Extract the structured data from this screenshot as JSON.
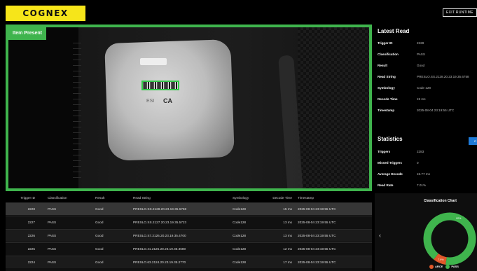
{
  "header": {
    "logo": "COGNEX",
    "exit_label": "EXIT RUNTIME"
  },
  "image": {
    "status_label": "Item Present",
    "package_text": "CA",
    "package_sub": "ESI"
  },
  "latest_read": {
    "title": "Latest Read",
    "fields": [
      {
        "label": "Trigger ID",
        "value": "2228"
      },
      {
        "label": "Classification",
        "value": "PASS"
      },
      {
        "label": "Result",
        "value": "Good"
      },
      {
        "label": "Read String",
        "value": "PRESLO.SS.2128.20.23.19.35.6758"
      },
      {
        "label": "Symbology",
        "value": "Code 128"
      },
      {
        "label": "Decode Time",
        "value": "19 ms"
      },
      {
        "label": "Timestamp",
        "value": "2025-08-04 23:19:55 UTC"
      }
    ]
  },
  "statistics": {
    "title": "Statistics",
    "button_label": "R",
    "fields": [
      {
        "label": "Triggers",
        "value": "2283"
      },
      {
        "label": "Missed Triggers",
        "value": "0"
      },
      {
        "label": "Average Decode",
        "value": "15.77 ms"
      },
      {
        "label": "Read Rate",
        "value": "7.01%"
      }
    ]
  },
  "table": {
    "columns": [
      "Trigger ID",
      "Classification",
      "Result",
      "Read String",
      "Symbology",
      "Decode Time",
      "Timestamp"
    ],
    "rows": [
      [
        "2228",
        "PASS",
        "Good",
        "PRESLO.SS.2128.20.23.19.35.6758",
        "Code128",
        "15 ms",
        "2025-08-04 23:19:55 UTC"
      ],
      [
        "2227",
        "PASS",
        "Good",
        "PRESLO.SS.2127.20.23.19.35.5723",
        "Code128",
        "13 ms",
        "2025-08-04 23:19:55 UTC"
      ],
      [
        "2226",
        "PASS",
        "Good",
        "PRESLO.S7.2126.20.23.19.35.4700",
        "Code128",
        "13 ms",
        "2025-08-04 23:19:55 UTC"
      ],
      [
        "2225",
        "PASS",
        "Good",
        "PRESLO.41.2125.20.23.19.35.3680",
        "Code128",
        "12 ms",
        "2025-08-04 23:19:55 UTC"
      ],
      [
        "2224",
        "PASS",
        "Good",
        "PRESLO.63.2124.20.23.19.35.2770",
        "Code128",
        "17 ms",
        "2025-08-04 23:19:55 UTC"
      ]
    ]
  },
  "chart_data": {
    "type": "pie",
    "title": "Classification Chart",
    "categories": [
      "PASS",
      "ARCE"
    ],
    "values": [
      92.03,
      7.97
    ],
    "labels": [
      "92%",
      "7.9%"
    ],
    "colors": {
      "PASS": "#3fb44d",
      "ARCE": "#e0582a"
    },
    "legend_position": "bottom"
  }
}
